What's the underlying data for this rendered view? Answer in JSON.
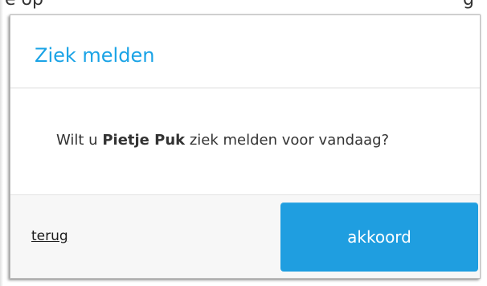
{
  "background_fragment": "e op ... ... ... g",
  "dialog": {
    "title": "Ziek melden",
    "message": {
      "prefix": "Wilt u ",
      "name": "Pietje Puk",
      "suffix": " ziek melden voor vandaag?"
    },
    "back_label": "terug",
    "accept_label": "akkoord"
  },
  "colors": {
    "title": "#1aa3e6",
    "accent_button": "#1f9ee0",
    "text": "#333333"
  }
}
